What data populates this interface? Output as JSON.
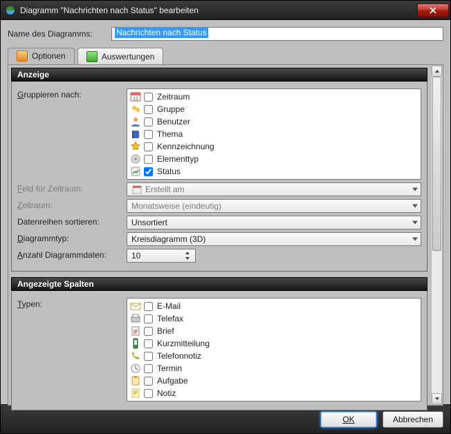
{
  "window": {
    "title": "Diagramm \"Nachrichten nach Status\" bearbeiten"
  },
  "name_field": {
    "label": "Name des Diagramms:",
    "value": "Nachrichten nach Status"
  },
  "tabs": {
    "options": "Optionen",
    "evaluations": "Auswertungen"
  },
  "panels": {
    "display": {
      "title": "Anzeige",
      "group_by_label": "Gruppieren nach:",
      "group_by_hotkey": "G",
      "group_items": [
        {
          "icon": "calendar-icon",
          "label": "Zeitraum",
          "checked": false
        },
        {
          "icon": "group-icon",
          "label": "Gruppe",
          "checked": false
        },
        {
          "icon": "user-icon",
          "label": "Benutzer",
          "checked": false
        },
        {
          "icon": "book-icon",
          "label": "Thema",
          "checked": false
        },
        {
          "icon": "star-icon",
          "label": "Kennzeichnung",
          "checked": false
        },
        {
          "icon": "disc-icon",
          "label": "Elementtyp",
          "checked": false
        },
        {
          "icon": "status-icon",
          "label": "Status",
          "checked": true
        }
      ],
      "field_period_label": "Feld für Zeitraum:",
      "field_period_hotkey": "F",
      "field_period_value": "Erstellt am",
      "period_label": "Zeitraum:",
      "period_hotkey": "Z",
      "period_value": "Monatsweise (eindeutig)",
      "sort_label": "Datenreihen sortieren:",
      "sort_value": "Unsortiert",
      "charttype_label": "Diagrammtyp:",
      "charttype_hotkey": "D",
      "charttype_value": "Kreisdiagramm (3D)",
      "count_label": "Anzahl Diagrammdaten:",
      "count_hotkey": "A",
      "count_value": "10"
    },
    "columns": {
      "title": "Angezeigte Spalten",
      "types_label": "Typen:",
      "types_hotkey": "T",
      "type_items": [
        {
          "icon": "email-icon",
          "label": "E-Mail",
          "checked": false
        },
        {
          "icon": "fax-icon",
          "label": "Telefax",
          "checked": false
        },
        {
          "icon": "letter-icon",
          "label": "Brief",
          "checked": false
        },
        {
          "icon": "sms-icon",
          "label": "Kurzmitteilung",
          "checked": false
        },
        {
          "icon": "phone-icon",
          "label": "Telefonnotiz",
          "checked": false
        },
        {
          "icon": "clock-icon",
          "label": "Termin",
          "checked": false
        },
        {
          "icon": "task-icon",
          "label": "Aufgabe",
          "checked": false
        },
        {
          "icon": "note-icon",
          "label": "Notiz",
          "checked": false
        }
      ]
    }
  },
  "buttons": {
    "ok": "OK",
    "cancel": "Abbrechen"
  },
  "colors": {
    "selection": "#3399ff",
    "panel_hdr": "#141414",
    "chrome": "#bfbfbf"
  }
}
